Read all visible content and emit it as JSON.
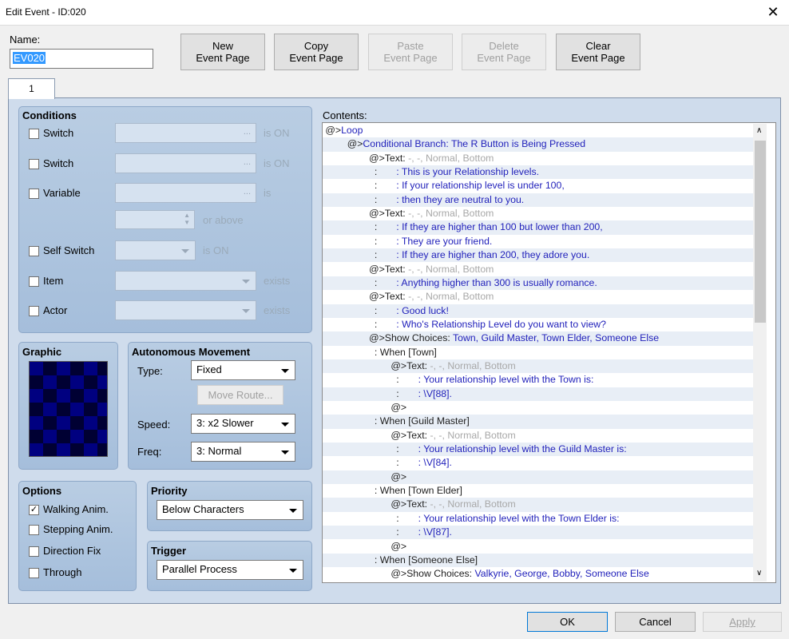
{
  "window": {
    "title": "Edit Event - ID:020",
    "close_glyph": "✕"
  },
  "name": {
    "label": "Name:",
    "value": "EV020"
  },
  "toolbar": {
    "new_1": "New",
    "new_2": "Event Page",
    "copy_1": "Copy",
    "copy_2": "Event Page",
    "paste_1": "Paste",
    "paste_2": "Event Page",
    "delete_1": "Delete",
    "delete_2": "Event Page",
    "clear_1": "Clear",
    "clear_2": "Event Page"
  },
  "tabs": [
    {
      "label": "1"
    }
  ],
  "conditions": {
    "title": "Conditions",
    "switch1": "Switch",
    "switch2": "Switch",
    "variable": "Variable",
    "self_switch": "Self Switch",
    "item": "Item",
    "actor": "Actor",
    "is_on": "is ON",
    "is": "is",
    "or_above": "or above",
    "exists": "exists",
    "ellipsis": "..."
  },
  "graphic": {
    "title": "Graphic"
  },
  "movement": {
    "title": "Autonomous Movement",
    "type_label": "Type:",
    "type_value": "Fixed",
    "move_route": "Move Route...",
    "speed_label": "Speed:",
    "speed_value": "3: x2 Slower",
    "freq_label": "Freq:",
    "freq_value": "3: Normal"
  },
  "options": {
    "title": "Options",
    "walking": "Walking Anim.",
    "stepping": "Stepping Anim.",
    "direction": "Direction Fix",
    "through": "Through",
    "checked_mark": "✓"
  },
  "priority": {
    "title": "Priority",
    "value": "Below Characters"
  },
  "trigger": {
    "title": "Trigger",
    "value": "Parallel Process"
  },
  "contents": {
    "label": "Contents:",
    "lines": [
      {
        "indent": "",
        "prefix": "@>",
        "main": "Loop",
        "gray": "",
        "alt": false
      },
      {
        "indent": "    ",
        "prefix": "@>",
        "main": "Conditional Branch: The R Button is Being Pressed",
        "gray": "",
        "alt": true
      },
      {
        "indent": "        ",
        "prefix": "@>Text: ",
        "main": "",
        "gray": "-, -, Normal, Bottom",
        "alt": false
      },
      {
        "indent": "         ",
        "prefix": ":       ",
        "main": ": This is your Relationship levels.",
        "gray": "",
        "alt": true
      },
      {
        "indent": "         ",
        "prefix": ":       ",
        "main": ": If your relationship level is under 100,",
        "gray": "",
        "alt": false
      },
      {
        "indent": "         ",
        "prefix": ":       ",
        "main": ": then they are neutral to you.",
        "gray": "",
        "alt": true
      },
      {
        "indent": "        ",
        "prefix": "@>Text: ",
        "main": "",
        "gray": "-, -, Normal, Bottom",
        "alt": false
      },
      {
        "indent": "         ",
        "prefix": ":       ",
        "main": ": If they are higher than 100 but lower than 200,",
        "gray": "",
        "alt": true
      },
      {
        "indent": "         ",
        "prefix": ":       ",
        "main": ": They are your friend.",
        "gray": "",
        "alt": false
      },
      {
        "indent": "         ",
        "prefix": ":       ",
        "main": ": If they are higher than 200, they adore you.",
        "gray": "",
        "alt": true
      },
      {
        "indent": "        ",
        "prefix": "@>Text: ",
        "main": "",
        "gray": "-, -, Normal, Bottom",
        "alt": false
      },
      {
        "indent": "         ",
        "prefix": ":       ",
        "main": ": Anything higher than 300 is usually romance.",
        "gray": "",
        "alt": true
      },
      {
        "indent": "        ",
        "prefix": "@>Text: ",
        "main": "",
        "gray": "-, -, Normal, Bottom",
        "alt": false
      },
      {
        "indent": "         ",
        "prefix": ":       ",
        "main": ": Good luck!",
        "gray": "",
        "alt": true
      },
      {
        "indent": "         ",
        "prefix": ":       ",
        "main": ": Who's Relationship Level do you want to view?",
        "gray": "",
        "alt": false
      },
      {
        "indent": "        ",
        "prefix": "@>Show Choices: ",
        "main": "Town, Guild Master, Town Elder, Someone Else",
        "gray": "",
        "alt": true
      },
      {
        "indent": "         ",
        "prefix": ": When [Town]",
        "main": "",
        "gray": "",
        "alt": false
      },
      {
        "indent": "            ",
        "prefix": "@>Text: ",
        "main": "",
        "gray": "-, -, Normal, Bottom",
        "alt": true
      },
      {
        "indent": "             ",
        "prefix": ":       ",
        "main": ": Your relationship level with the Town is:",
        "gray": "",
        "alt": false
      },
      {
        "indent": "             ",
        "prefix": ":       ",
        "main": ": \\V[88].",
        "gray": "",
        "alt": true
      },
      {
        "indent": "            ",
        "prefix": "@>",
        "main": "",
        "gray": "",
        "alt": false
      },
      {
        "indent": "         ",
        "prefix": ": When [Guild Master]",
        "main": "",
        "gray": "",
        "alt": true
      },
      {
        "indent": "            ",
        "prefix": "@>Text: ",
        "main": "",
        "gray": "-, -, Normal, Bottom",
        "alt": false
      },
      {
        "indent": "             ",
        "prefix": ":       ",
        "main": ": Your relationship level with the Guild Master is:",
        "gray": "",
        "alt": true
      },
      {
        "indent": "             ",
        "prefix": ":       ",
        "main": ": \\V[84].",
        "gray": "",
        "alt": false
      },
      {
        "indent": "            ",
        "prefix": "@>",
        "main": "",
        "gray": "",
        "alt": true
      },
      {
        "indent": "         ",
        "prefix": ": When [Town Elder]",
        "main": "",
        "gray": "",
        "alt": false
      },
      {
        "indent": "            ",
        "prefix": "@>Text: ",
        "main": "",
        "gray": "-, -, Normal, Bottom",
        "alt": true
      },
      {
        "indent": "             ",
        "prefix": ":       ",
        "main": ": Your relationship level with the Town Elder is:",
        "gray": "",
        "alt": false
      },
      {
        "indent": "             ",
        "prefix": ":       ",
        "main": ": \\V[87].",
        "gray": "",
        "alt": true
      },
      {
        "indent": "            ",
        "prefix": "@>",
        "main": "",
        "gray": "",
        "alt": false
      },
      {
        "indent": "         ",
        "prefix": ": When [Someone Else]",
        "main": "",
        "gray": "",
        "alt": true
      },
      {
        "indent": "            ",
        "prefix": "@>Show Choices: ",
        "main": "Valkyrie, George, Bobby, Someone Else",
        "gray": "",
        "alt": false
      }
    ]
  },
  "footer": {
    "ok": "OK",
    "cancel": "Cancel",
    "apply": "Apply"
  },
  "colors": {
    "command_text": "#2222bb",
    "param_gray": "#a8a8a8",
    "panel_bg": "#b0c6e0",
    "tab_body": "#cfdcec"
  }
}
